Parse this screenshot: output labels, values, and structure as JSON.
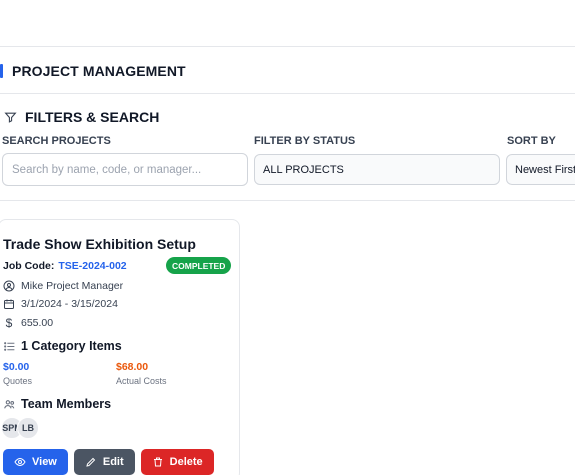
{
  "header": {
    "title": "PROJECT MANAGEMENT"
  },
  "filters": {
    "title": "FILTERS & SEARCH",
    "search_label": "SEARCH PROJECTS",
    "search_placeholder": "Search by name, code, or manager...",
    "status_label": "FILTER BY STATUS",
    "status_value": "ALL PROJECTS",
    "sort_label": "SORT BY",
    "sort_value": "Newest First"
  },
  "project": {
    "title": "Trade Show Exhibition Setup",
    "job_code_label": "Job Code:",
    "job_code": "TSE-2024-002",
    "status": "COMPLETED",
    "manager": "Mike Project Manager",
    "dates": "3/1/2024 - 3/15/2024",
    "budget": "655.00",
    "category_items": "1 Category Items",
    "quotes_value": "$0.00",
    "quotes_label": "Quotes",
    "actual_value": "$68.00",
    "actual_label": "Actual Costs",
    "team_title": "Team Members",
    "members": [
      "SPM",
      "LB"
    ]
  },
  "actions": {
    "view": "View",
    "edit": "Edit",
    "delete": "Delete"
  },
  "colors": {
    "accent": "#2563eb",
    "success": "#16a34a",
    "danger": "#dc2626",
    "cost": "#ea580c"
  }
}
